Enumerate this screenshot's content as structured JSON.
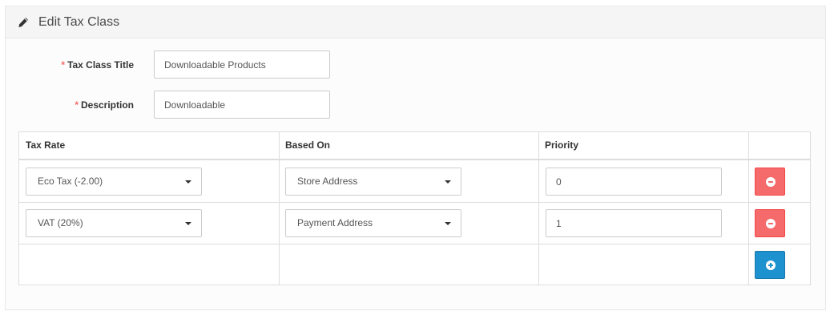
{
  "panel": {
    "title": "Edit Tax Class",
    "icon": "pencil-icon"
  },
  "form": {
    "title_label": "Tax Class Title",
    "title_value": "Downloadable Products",
    "description_label": "Description",
    "description_value": "Downloadable",
    "required_marker": "*"
  },
  "table": {
    "headers": [
      "Tax Rate",
      "Based On",
      "Priority"
    ],
    "rows": [
      {
        "tax_rate": "Eco Tax (-2.00)",
        "based_on": "Store Address",
        "priority": "0"
      },
      {
        "tax_rate": "VAT (20%)",
        "based_on": "Payment Address",
        "priority": "1"
      }
    ]
  },
  "colors": {
    "danger": "#f56b6b",
    "primary": "#1e91cf"
  }
}
